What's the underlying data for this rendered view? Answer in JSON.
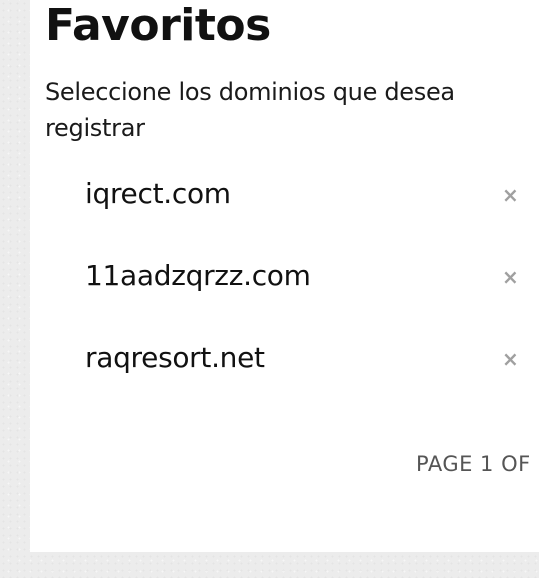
{
  "favorites": {
    "title": "Favoritos",
    "subtitle": "Seleccione los dominios que desea registrar",
    "remove_glyph": "×",
    "domains": [
      {
        "name": "iqrect.com"
      },
      {
        "name": "11aadzqrzz.com"
      },
      {
        "name": "raqresort.net"
      }
    ],
    "pagination": "PAGE 1 OF"
  }
}
